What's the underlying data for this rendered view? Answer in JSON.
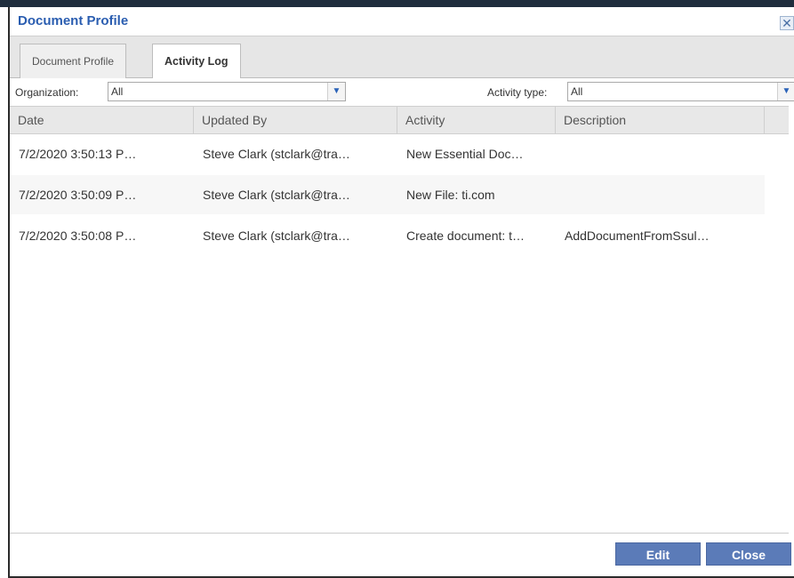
{
  "dialog": {
    "title": "Document Profile",
    "close_glyph": "✕"
  },
  "tabs": [
    {
      "label": "Document Profile",
      "active": false
    },
    {
      "label": "Activity Log",
      "active": true
    }
  ],
  "filters": {
    "organization_label": "Organization:",
    "organization_value": "All",
    "activity_type_label": "Activity type:",
    "activity_type_value": "All"
  },
  "grid": {
    "columns": [
      "Date",
      "Updated By",
      "Activity",
      "Description"
    ],
    "rows": [
      {
        "date": "7/2/2020 3:50:13 P…",
        "updated_by": "Steve Clark (stclark@tra…",
        "activity": "New Essential Doc…",
        "description": ""
      },
      {
        "date": "7/2/2020 3:50:09 P…",
        "updated_by": "Steve Clark (stclark@tra…",
        "activity": "New File: ti.com",
        "description": ""
      },
      {
        "date": "7/2/2020 3:50:08 P…",
        "updated_by": "Steve Clark (stclark@tra…",
        "activity": "Create document: t…",
        "description": "AddDocumentFromSsul…"
      }
    ]
  },
  "buttons": {
    "edit": "Edit",
    "close": "Close"
  },
  "icons": {
    "dropdown": "chevron-down-icon",
    "close": "close-icon"
  },
  "colors": {
    "title": "#2a5db0",
    "button": "#5b7bb8"
  }
}
